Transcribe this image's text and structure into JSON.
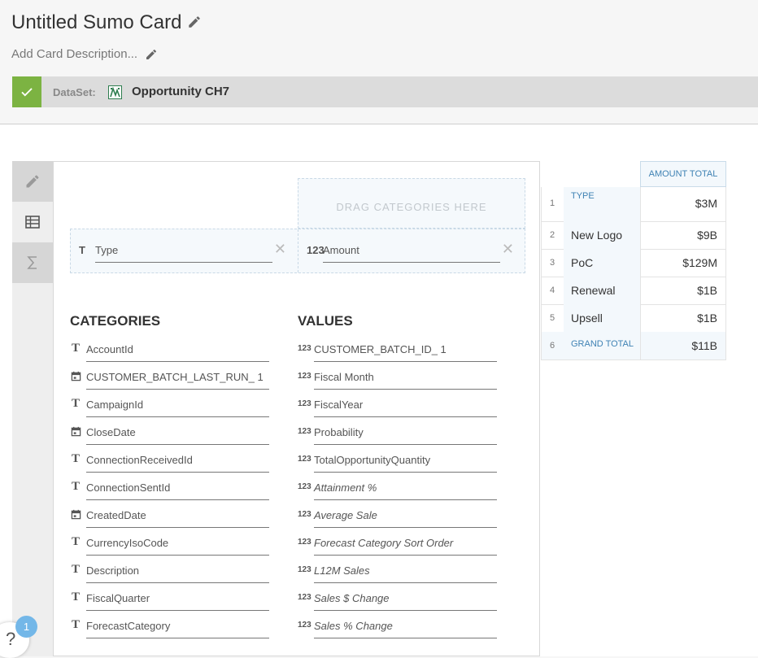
{
  "header": {
    "title": "Untitled Sumo Card",
    "description_placeholder": "Add Card Description...",
    "edit_title_icon": "pencil-icon",
    "edit_description_icon": "pencil-icon"
  },
  "dataset": {
    "label": "DataSet:",
    "name": "Opportunity CH7",
    "status_icon": "check-icon",
    "status_color": "#7cb342"
  },
  "toolbar": {
    "items": [
      {
        "name": "edit",
        "icon": "pencil-icon"
      },
      {
        "name": "table",
        "icon": "table-icon"
      },
      {
        "name": "sum",
        "icon": "sigma-icon"
      }
    ]
  },
  "builder": {
    "drop_text": "DRAG CATEGORIES HERE",
    "row_field": {
      "icon": "T",
      "label": "Type"
    },
    "value_field": {
      "icon": "123",
      "label": "Amount"
    },
    "remove_icon": "close-icon"
  },
  "categories": {
    "heading": "CATEGORIES",
    "items": [
      {
        "type": "text",
        "label": "AccountId"
      },
      {
        "type": "date",
        "label": "CUSTOMER_BATCH_LAST_RUN_ 1"
      },
      {
        "type": "text",
        "label": "CampaignId"
      },
      {
        "type": "date",
        "label": "CloseDate"
      },
      {
        "type": "text",
        "label": "ConnectionReceivedId"
      },
      {
        "type": "text",
        "label": "ConnectionSentId"
      },
      {
        "type": "date",
        "label": "CreatedDate"
      },
      {
        "type": "text",
        "label": "CurrencyIsoCode"
      },
      {
        "type": "text",
        "label": "Description"
      },
      {
        "type": "text",
        "label": "FiscalQuarter"
      },
      {
        "type": "text",
        "label": "ForecastCategory"
      }
    ]
  },
  "values": {
    "heading": "VALUES",
    "items": [
      {
        "label": "CUSTOMER_BATCH_ID_ 1",
        "italic": false
      },
      {
        "label": "Fiscal Month",
        "italic": false
      },
      {
        "label": "FiscalYear",
        "italic": false
      },
      {
        "label": "Probability",
        "italic": false
      },
      {
        "label": "TotalOpportunityQuantity",
        "italic": false
      },
      {
        "label": "Attainment %",
        "italic": true
      },
      {
        "label": "Average Sale",
        "italic": true
      },
      {
        "label": "Forecast Category Sort Order",
        "italic": true
      },
      {
        "label": "L12M Sales",
        "italic": true
      },
      {
        "label": "Sales $ Change",
        "italic": true
      },
      {
        "label": "Sales % Change",
        "italic": true
      }
    ]
  },
  "table": {
    "value_header": "AMOUNT TOTAL",
    "rows": [
      {
        "num": "1",
        "category": "TYPE",
        "value": "$3M"
      },
      {
        "num": "2",
        "category": "New Logo",
        "value": "$9B"
      },
      {
        "num": "3",
        "category": "PoC",
        "value": "$129M"
      },
      {
        "num": "4",
        "category": "Renewal",
        "value": "$1B"
      },
      {
        "num": "5",
        "category": "Upsell",
        "value": "$1B"
      },
      {
        "num": "6",
        "category": "GRAND TOTAL",
        "value": "$11B"
      }
    ]
  },
  "help": {
    "label": "?",
    "badge_count": "1"
  }
}
